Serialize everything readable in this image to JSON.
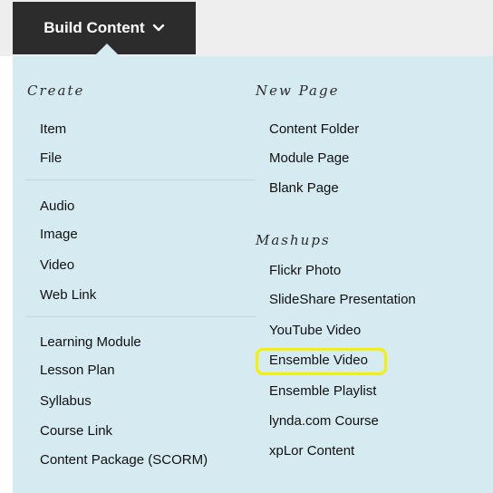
{
  "toolbar": {
    "build_content_label": "Build Content",
    "chevron_icon": "chevron-down-icon"
  },
  "colors": {
    "button_bg": "#2c2c2c",
    "panel_bg": "#d5eaf1",
    "highlight": "#f5ef00"
  },
  "create": {
    "heading": "Create",
    "group1": [
      "Item",
      "File"
    ],
    "group2": [
      "Audio",
      "Image",
      "Video",
      "Web Link"
    ],
    "group3": [
      "Learning Module",
      "Lesson Plan",
      "Syllabus",
      "Course Link",
      "Content Package (SCORM)"
    ]
  },
  "new_page": {
    "heading": "New Page",
    "items": [
      "Content Folder",
      "Module Page",
      "Blank Page"
    ]
  },
  "mashups": {
    "heading": "Mashups",
    "items": [
      "Flickr Photo",
      "SlideShare Presentation",
      "YouTube Video",
      "Ensemble Video",
      "Ensemble Playlist",
      "lynda.com Course",
      "xpLor Content"
    ]
  },
  "highlighted_item": "Ensemble Video"
}
